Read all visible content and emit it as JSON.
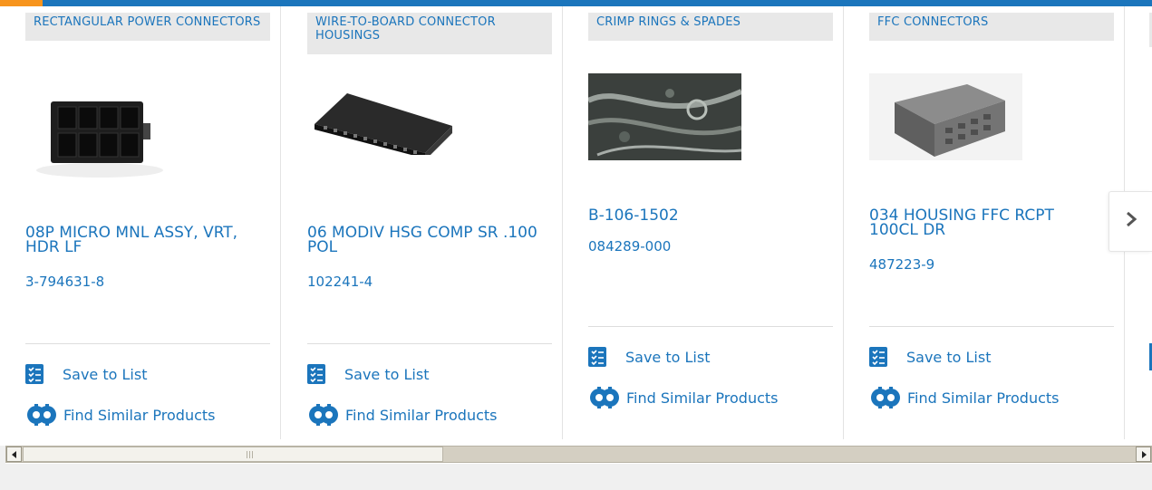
{
  "cards": [
    {
      "category": "RECTANGULAR POWER CONNECTORS",
      "title": "08P MICRO MNL ASSY, VRT, HDR LF",
      "part_number": "3-794631-8",
      "save_label": "Save to List",
      "similar_label": "Find Similar Products"
    },
    {
      "category": "WIRE-TO-BOARD CONNECTOR HOUSINGS",
      "title": "06 MODIV HSG COMP SR .100 POL",
      "part_number": "102241-4",
      "save_label": "Save to List",
      "similar_label": "Find Similar Products"
    },
    {
      "category": "CRIMP RINGS & SPADES",
      "title": "B-106-1502",
      "part_number": "084289-000",
      "save_label": "Save to List",
      "similar_label": "Find Similar Products"
    },
    {
      "category": "FFC CONNECTORS",
      "title": "034 HOUSING FFC RCPT 100CL DR",
      "part_number": "487223-9",
      "save_label": "Save to List",
      "similar_label": "Find Similar Products"
    }
  ],
  "carousel": {
    "next_icon": "chevron-right-icon"
  },
  "colors": {
    "brand_blue": "#1b75bc",
    "accent_orange": "#f7941d",
    "category_bg": "#e8e8e8"
  }
}
